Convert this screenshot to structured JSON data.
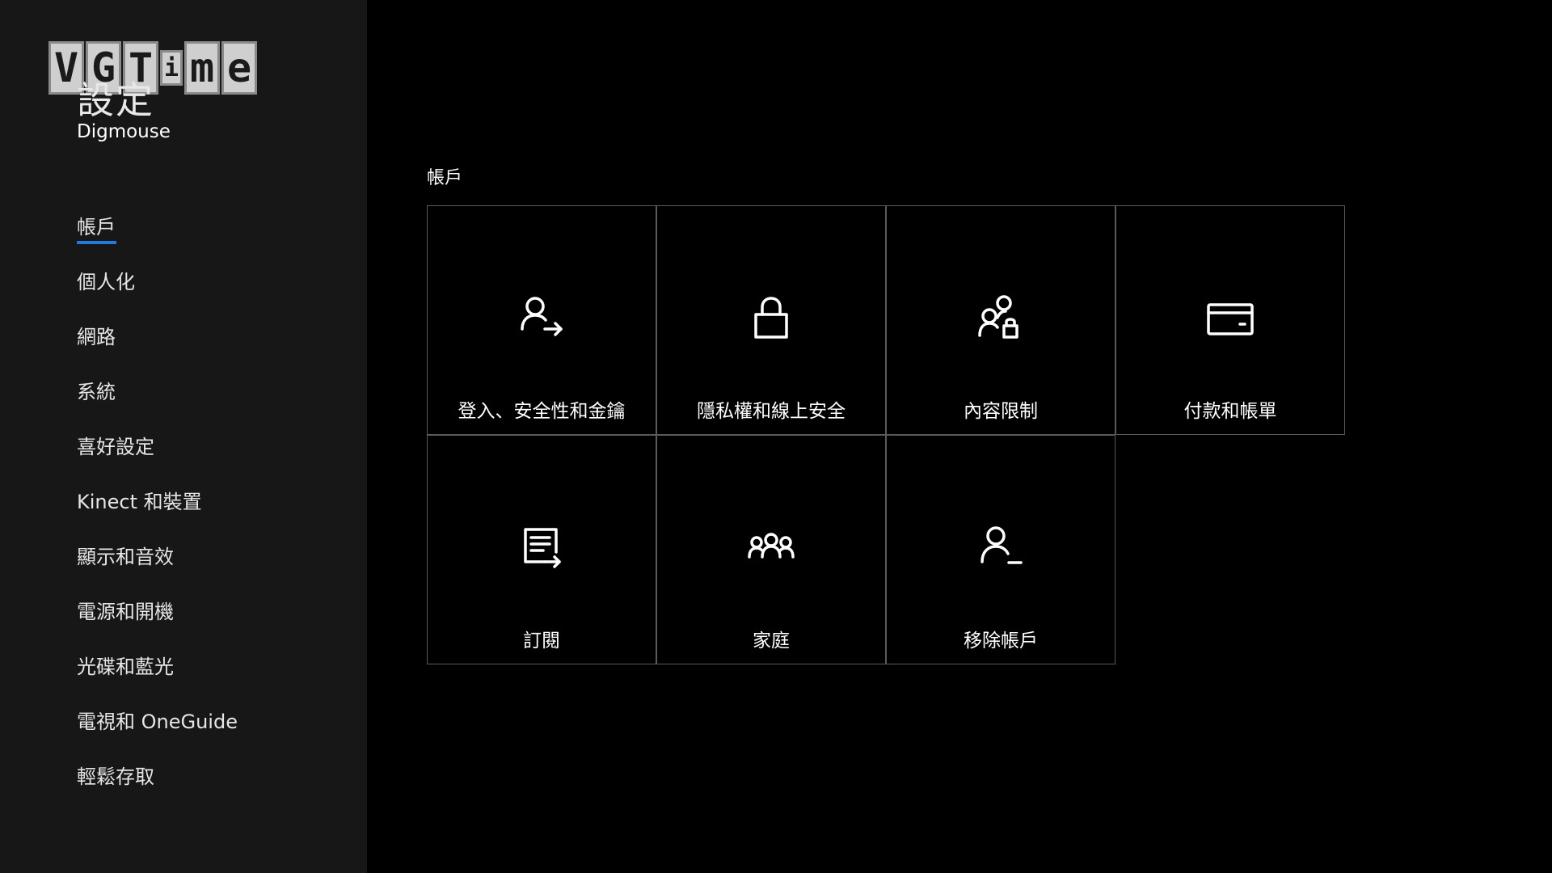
{
  "watermark": {
    "letters": [
      "V",
      "G",
      "T",
      "i",
      "m",
      "e"
    ]
  },
  "sidebar": {
    "title": "設定",
    "gamertag": "Digmouse",
    "items": [
      {
        "label": "帳戶",
        "active": true
      },
      {
        "label": "個人化"
      },
      {
        "label": "網路"
      },
      {
        "label": "系統"
      },
      {
        "label": "喜好設定"
      },
      {
        "label": "Kinect 和裝置"
      },
      {
        "label": "顯示和音效"
      },
      {
        "label": "電源和開機"
      },
      {
        "label": "光碟和藍光"
      },
      {
        "label": "電視和 OneGuide"
      },
      {
        "label": "輕鬆存取"
      }
    ]
  },
  "main": {
    "section_title": "帳戶",
    "tiles": [
      {
        "label": "登入、安全性和金鑰",
        "icon": "person-arrow-icon"
      },
      {
        "label": "隱私權和線上安全",
        "icon": "lock-icon"
      },
      {
        "label": "內容限制",
        "icon": "people-lock-icon"
      },
      {
        "label": "付款和帳單",
        "icon": "credit-card-icon"
      },
      {
        "label": "訂閱",
        "icon": "document-arrow-icon"
      },
      {
        "label": "家庭",
        "icon": "family-icon"
      },
      {
        "label": "移除帳戶",
        "icon": "person-minus-icon"
      }
    ]
  },
  "colors": {
    "background": "#000000",
    "sidebar": "#171717",
    "accent": "#1f7ad9",
    "tile_border": "#5a5a5a"
  }
}
